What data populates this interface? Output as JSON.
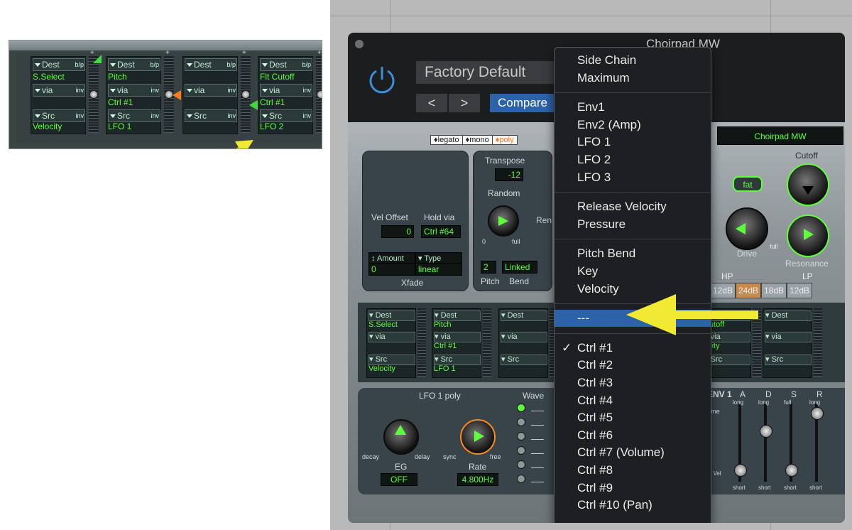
{
  "inset": {
    "slots": [
      {
        "dest_label": "Dest",
        "dest_value": "S.Select",
        "via_label": "via",
        "via_value": "",
        "src_label": "Src",
        "src_value": "Velocity",
        "bp": "b/p",
        "inv1": "inv",
        "inv2": "inv"
      },
      {
        "dest_label": "Dest",
        "dest_value": "Pitch",
        "via_label": "via",
        "via_value": "Ctrl #1",
        "src_label": "Src",
        "src_value": "LFO 1",
        "bp": "b/p",
        "inv1": "inv",
        "inv2": "inv"
      },
      {
        "dest_label": "Dest",
        "dest_value": "",
        "via_label": "via",
        "via_value": "",
        "src_label": "Src",
        "src_value": "",
        "bp": "b/p",
        "inv1": "inv",
        "inv2": "inv"
      },
      {
        "dest_label": "Dest",
        "dest_value": "Flt Cutoff",
        "via_label": "via",
        "via_value": "Ctrl #1",
        "src_label": "Src",
        "src_value": "LFO 2",
        "bp": "b/p",
        "inv1": "inv",
        "inv2": "inv"
      }
    ]
  },
  "window": {
    "title": "Choirpad MW",
    "preset": "Factory Default",
    "nav_prev": "<",
    "nav_next": ">",
    "compare": "Compare",
    "power_icon": "power-icon"
  },
  "es2": {
    "modes": [
      "legato",
      "mono",
      "poly"
    ],
    "active_mode": "poly",
    "patch_name": "Choirpad MW",
    "transpose_label": "Transpose",
    "transpose_value": "-12",
    "random_label": "Random",
    "random_min": "0",
    "random_max": "full",
    "pitch_bend_label": "Pitch",
    "bend_label": "Bend",
    "pitch_bend_value": "2",
    "bend_linked": "Linked",
    "vel_offset_label": "Vel Offset",
    "vel_offset_value": "0",
    "hold_via_label": "Hold via",
    "hold_via_value": "Ctrl #64",
    "amount_label": "Amount",
    "type_label": "Type",
    "amount_value": "0",
    "type_value": "linear",
    "xfade_label": "Xfade",
    "ren_partial": "Ren",
    "fat_label": "fat",
    "drive_label": "Drive",
    "drive_max": "full",
    "cutoff_label": "Cutoff",
    "resonance_label": "Resonance",
    "hp_label": "HP",
    "lp_label": "LP",
    "slopes": [
      "12dB",
      "24dB",
      "18dB",
      "12dB"
    ],
    "router_slots": [
      {
        "dest_value": "S.Select",
        "via_value": "",
        "src_value": "Velocity"
      },
      {
        "dest_value": "Pitch",
        "via_value": "Ctrl #1",
        "src_value": "LFO 1"
      },
      {
        "dest_value": "",
        "via_value": "",
        "src_value": ""
      },
      {
        "dest_value": "Cutoff",
        "via_value": "ocity",
        "src_value": "1"
      },
      {
        "dest_value": "",
        "via_value": "",
        "src_value": ""
      }
    ],
    "lfo_title": "LFO 1  poly",
    "wave_label": "Wave",
    "eg_label": "EG",
    "eg_decay": "decay",
    "eg_delay": "delay",
    "eg_value": "OFF",
    "rate_label": "Rate",
    "rate_sync": "sync",
    "rate_free": "free",
    "rate_value": "4.800Hz",
    "env_title": "ENV 1",
    "env_cols": [
      "A",
      "D",
      "S",
      "R"
    ],
    "env_time": "Time",
    "env_long": "long",
    "env_full": "full",
    "env_short": "short",
    "env_via_vel": "via Vel"
  },
  "menu": {
    "groups": [
      [
        "Side Chain",
        "Maximum"
      ],
      [
        "Env1",
        "Env2 (Amp)",
        "LFO 1",
        "LFO 2",
        "LFO 3"
      ],
      [
        "Release Velocity",
        "Pressure"
      ],
      [
        "Pitch Bend",
        "Key",
        "Velocity"
      ],
      [
        "---"
      ],
      [
        "Ctrl #1",
        "Ctrl #2",
        "Ctrl #3",
        "Ctrl #4",
        "Ctrl #5",
        "Ctrl #6",
        "Ctrl #7 (Volume)",
        "Ctrl #8",
        "Ctrl #9",
        "Ctrl #10 (Pan)"
      ]
    ],
    "selected_item": "---",
    "checked_item": "Ctrl #1",
    "check_mark": "✓"
  },
  "colors": {
    "lcd_green": "#5dff3a",
    "arrow_yellow": "#f2ea32",
    "menu_highlight": "#2c63a8",
    "power_blue": "#3b8fd9"
  }
}
